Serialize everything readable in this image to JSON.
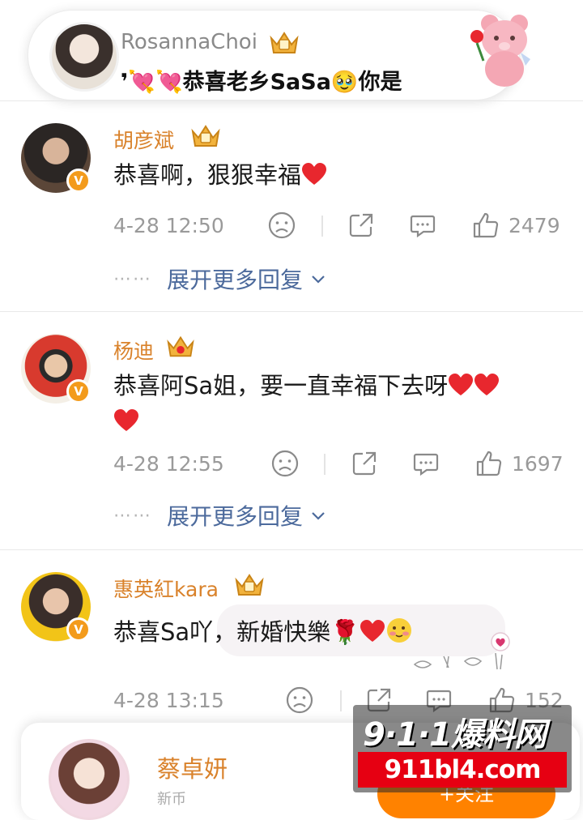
{
  "top_card": {
    "username": "RosannaChoi",
    "preview_text": "❜💘💘恭喜老乡SaSa🥹你是"
  },
  "comments": [
    {
      "name": "胡彦斌",
      "text": "恭喜啊，狠狠幸福",
      "time": "4-28 12:50",
      "likes": "2479",
      "more_replies": "展开更多回复",
      "more_dots": "⋯⋯"
    },
    {
      "name": "杨迪",
      "text": "恭喜阿Sa姐，要一直幸福下去呀",
      "time": "4-28 12:55",
      "likes": "1697",
      "more_replies": "展开更多回复",
      "more_dots": "⋯⋯"
    },
    {
      "name": "惠英紅kara",
      "text": "恭喜Sa吖，新婚快樂🌹",
      "time": "4-28 13:15",
      "likes": "152"
    }
  ],
  "bottom_card": {
    "name": "蔡卓妍",
    "subtitle": "新币",
    "follow_label": "+关注"
  },
  "watermark": {
    "top": "9·1·1爆料网",
    "bottom": "911bl4.com"
  },
  "colors": {
    "username": "#d9822b",
    "link": "#4c6a9c",
    "meta": "#9a9a9a",
    "verified_badge": "#f39b1c",
    "heart": "#e8272e",
    "watermark_red": "#e60012"
  },
  "icons": {
    "crown": "crown-icon",
    "verified": "verified-v-icon",
    "dislike": "frown-icon",
    "share": "share-icon",
    "comment": "comment-icon",
    "like": "thumbs-up-icon",
    "expand": "chevron-down-icon",
    "heart": "heart-icon"
  }
}
